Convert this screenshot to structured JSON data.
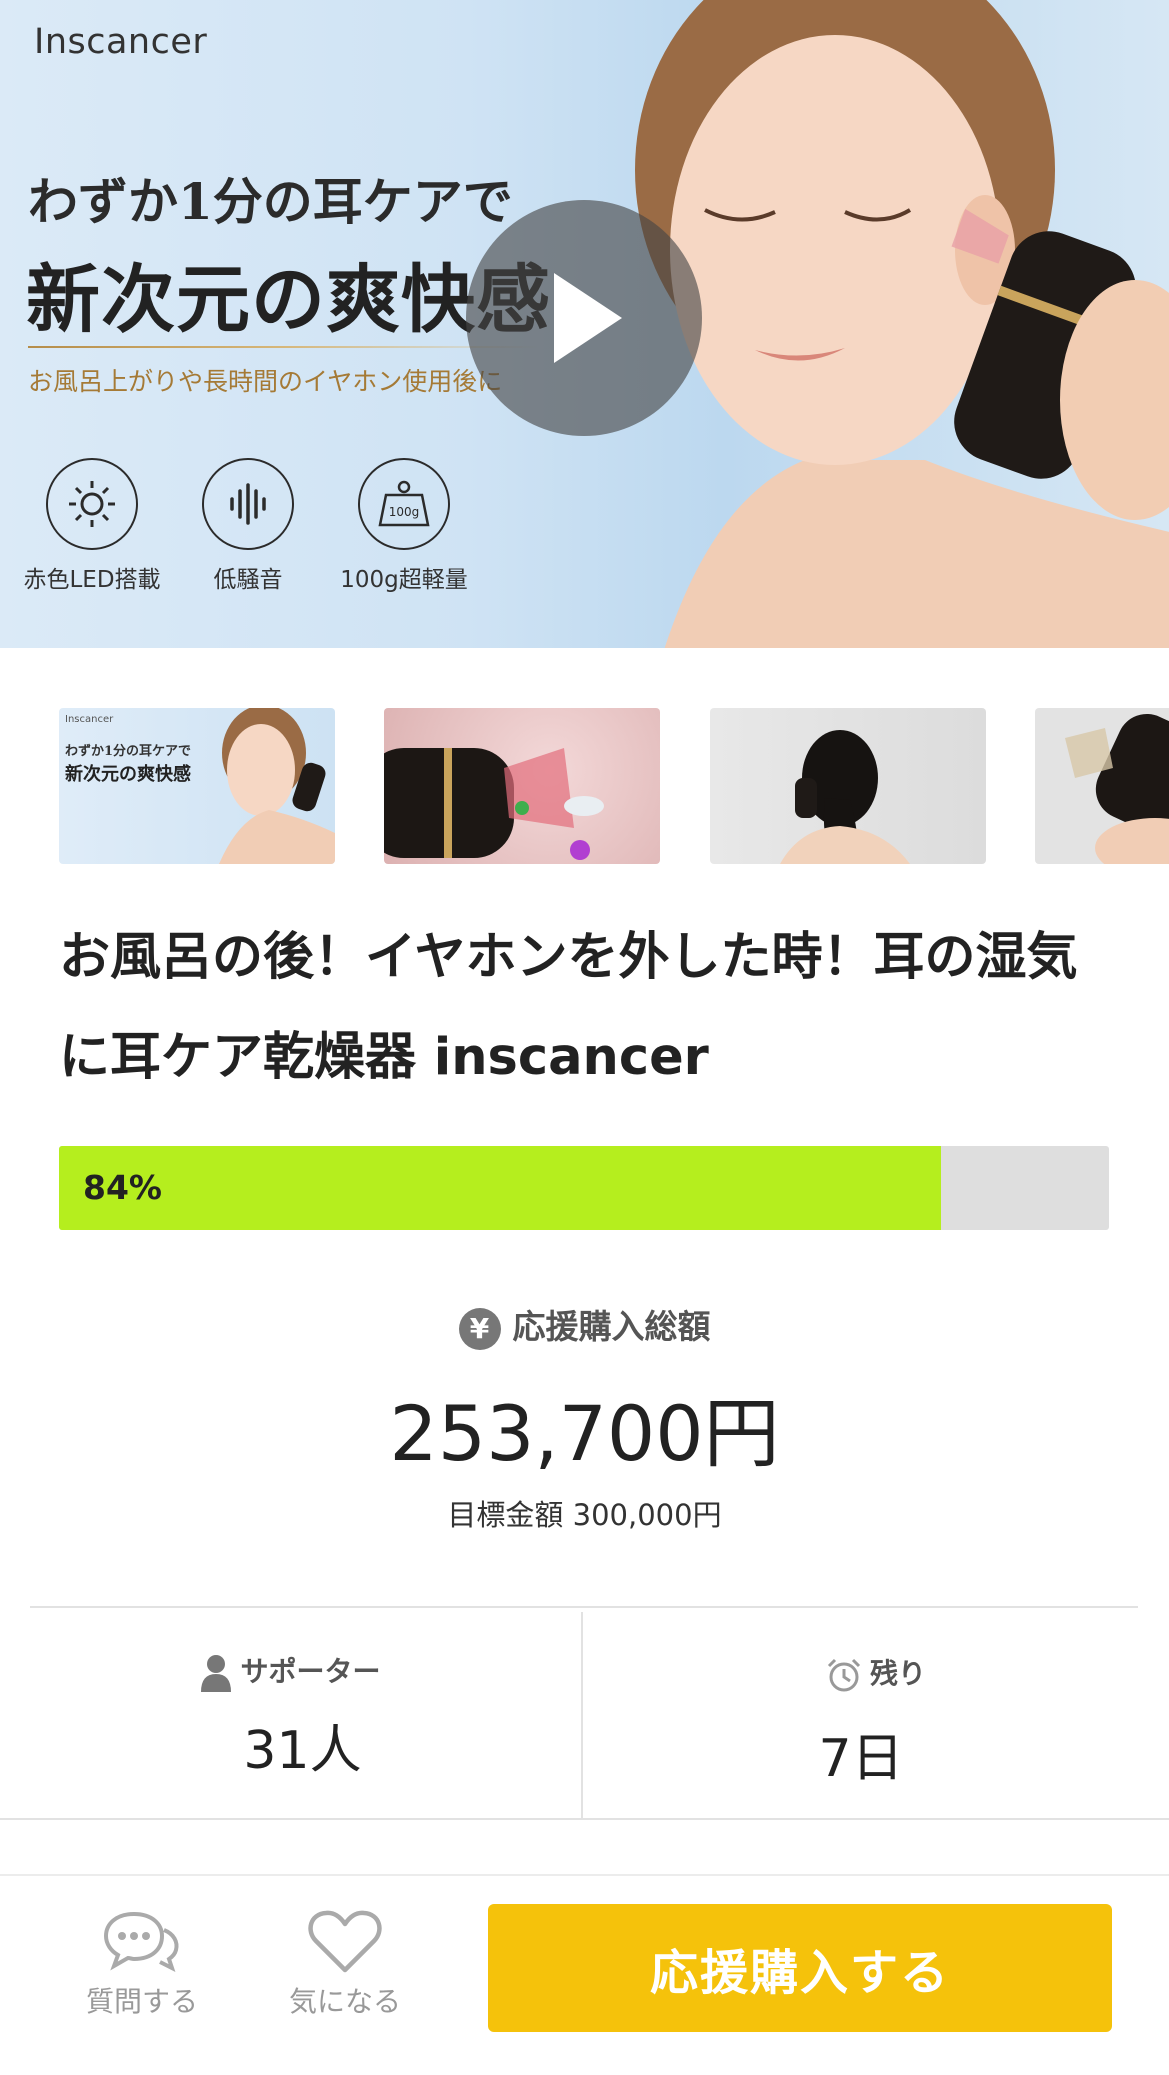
{
  "hero": {
    "brand": "Inscancer",
    "headline_line1": "わずか1分の耳ケアで",
    "headline_line2": "新次元の爽快感",
    "subheadline": "お風呂上がりや長時間のイヤホン使用後に",
    "features": [
      {
        "icon": "led-icon",
        "label": "赤色LED搭載"
      },
      {
        "icon": "sound-wave-icon",
        "label": "低騒音"
      },
      {
        "icon": "weight-icon",
        "label": "100g超軽量",
        "icon_text": "100g"
      }
    ],
    "play_icon": "play-icon"
  },
  "thumbnails": [
    {
      "caption_brand": "Inscancer",
      "caption_line1": "わずか1分の耳ケアで",
      "caption_line2": "新次元の爽快感"
    },
    {},
    {},
    {}
  ],
  "project": {
    "title": "お風呂の後！イヤホンを外した時！耳の湿気に耳ケア乾燥器 inscancer",
    "progress_percent": 84,
    "progress_label": "84%"
  },
  "funding": {
    "label": "応援購入総額",
    "label_icon": "yen-icon",
    "yen_symbol": "¥",
    "amount": "253,700円",
    "target": "目標金額 300,000円"
  },
  "stats": {
    "supporters_label": "サポーター",
    "supporters_value": "31人",
    "remaining_label": "残り",
    "remaining_value": "7日"
  },
  "bottom_bar": {
    "question_label": "質問する",
    "favorite_label": "気になる",
    "cta_label": "応援購入する"
  },
  "colors": {
    "progress_fill": "#b5ee1e",
    "progress_track": "#dedede",
    "cta": "#f5c20b"
  }
}
